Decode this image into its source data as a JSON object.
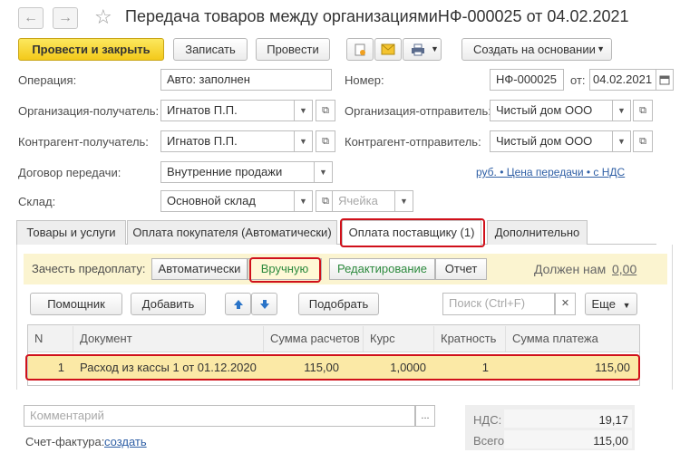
{
  "window": {
    "back_glyph": "←",
    "forward_glyph": "→",
    "favorite_glyph": "☆",
    "title": "Передача товаров между организациямиНФ-000025 от 04.02.2021"
  },
  "toolbar": {
    "post_close_label": "Провести и закрыть",
    "save_label": "Записать",
    "post_label": "Провести",
    "create_based_label": "Создать на основании"
  },
  "form": {
    "operation_label": "Операция:",
    "operation_value": "Авто: заполнен",
    "number_label": "Номер:",
    "number_value": "НФ-000025",
    "from_label": "от:",
    "date_value": "04.02.2021",
    "org_receiver_label": "Организация-получатель:",
    "org_receiver_value": "Игнатов П.П.",
    "org_sender_label": "Организация-отправитель:",
    "org_sender_value": "Чистый дом ООО",
    "contr_receiver_label": "Контрагент-получатель:",
    "contr_receiver_value": "Игнатов П.П.",
    "contr_sender_label": "Контрагент-отправитель:",
    "contr_sender_value": "Чистый дом ООО",
    "contract_label": "Договор передачи:",
    "contract_value": "Внутренние продажи",
    "price_link": "руб. • Цена передачи • с НДС",
    "warehouse_label": "Склад:",
    "warehouse_value": "Основной склад",
    "cell_placeholder": "Ячейка"
  },
  "tabs": [
    {
      "label": "Товары и услуги"
    },
    {
      "label": "Оплата покупателя (Автоматически)"
    },
    {
      "label": "Оплата поставщику (1)"
    },
    {
      "label": "Дополнительно"
    }
  ],
  "prepayment": {
    "label": "Зачесть предоплату:",
    "auto_label": "Автоматически",
    "manual_label": "Вручную",
    "edit_label": "Редактирование",
    "report_label": "Отчет",
    "owes_label": "Должен нам",
    "owes_value": "0,00"
  },
  "table_toolbar": {
    "assistant_label": "Помощник",
    "add_label": "Добавить",
    "pick_label": "Подобрать",
    "search_placeholder": "Поиск (Ctrl+F)",
    "more_label": "Еще"
  },
  "table": {
    "headers": [
      "N",
      "Документ",
      "Сумма расчетов",
      "Курс",
      "Кратность",
      "Сумма платежа"
    ],
    "rows": [
      [
        "1",
        "Расход из кассы 1 от 01.12.2020",
        "115,00",
        "1,0000",
        "1",
        "115,00"
      ]
    ]
  },
  "footer": {
    "comment_placeholder": "Комментарий",
    "invoice_label": "Счет-фактура:",
    "invoice_link": "создать",
    "vat_label": "НДС:",
    "vat_value": "19,17",
    "total_label": "Всего:",
    "total_value": "115,00"
  },
  "colors": {
    "accent_yellow": "#f3c91a",
    "highlight_red": "#d0101a",
    "link_blue": "#2f5fa5",
    "selected_row": "#fbe9a6",
    "green_text": "#2d8a3e"
  },
  "icons": [
    "back-arrow-icon",
    "forward-arrow-icon",
    "star-icon",
    "attach-icon",
    "envelope-icon",
    "printer-icon",
    "open-icon",
    "arrow-up-icon",
    "arrow-down-icon",
    "clear-icon"
  ]
}
